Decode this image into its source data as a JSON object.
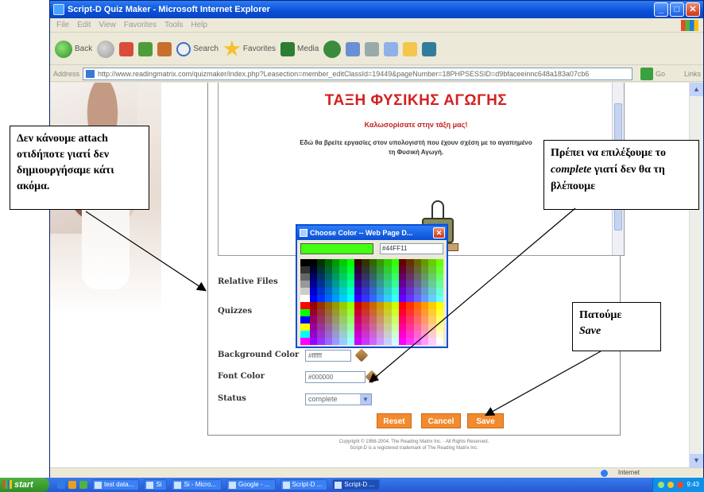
{
  "window": {
    "title": "Script-D Quiz Maker - Microsoft Internet Explorer",
    "controls": {
      "minimize": "_",
      "maximize": "□",
      "close": "✕"
    }
  },
  "menu": [
    "File",
    "Edit",
    "View",
    "Favorites",
    "Tools",
    "Help"
  ],
  "toolbar": {
    "back": "Back",
    "search": "Search",
    "favorites": "Favorites",
    "media": "Media"
  },
  "address": {
    "label": "Address",
    "url": "http://www.readingmatrix.com/quizmaker/index.php?Leasection=member_editClassId=19449&pageNumber=18PHPSESSID=d9bfaceeinnc648a183a07cb6",
    "go": "Go",
    "links": "Links"
  },
  "preview": {
    "title": "ΤΑΞΗ ΦΥΣΙΚΗΣ ΑΓΩΓΗΣ",
    "welcome": "Καλωσορίσατε στην τάξη μας!",
    "body_line1": "Εδώ θα βρείτε εργασίες στον υπολογιστή που έχουν σχέση με το αγαπημένο",
    "body_line2": "τη Φυσική Αγωγή."
  },
  "form": {
    "related_files_label": "Relative Files",
    "quizzes_label": "Quizzes",
    "background_color_label": "Background Color",
    "background_color_value": "#ffffff",
    "font_color_label": "Font Color",
    "font_color_value": "#000000",
    "status_label": "Status",
    "status_value": "complete",
    "reset": "Reset",
    "cancel": "Cancel",
    "save": "Save",
    "copyright_line1": "Copyright © 1998-2004. The Reading Matrix Inc. - All Rights Reserved.",
    "copyright_line2": "Script-D is a registered trademark of The Reading Matrix Inc."
  },
  "color_dialog": {
    "title": "Choose Color -- Web Page D...",
    "selected_hex": "#44FF11",
    "selected_color": "#44ff11"
  },
  "annotations": {
    "left": "Δεν κάνουμε attach οτιδήποτε γιατί δεν δημιουργήσαμε κάτι ακόμα.",
    "right_pre": "Πρέπει να επιλέξουμε το ",
    "right_em": "complete",
    "right_post": " γιατί δεν θα τη βλέπουμε",
    "save_pre": "Πατούμε",
    "save_em": "Save"
  },
  "statusbar": {
    "zone": "Internet"
  },
  "taskbar": {
    "start": "start",
    "tasks": [
      "test data...",
      "Si",
      "Si - Micro...",
      "Google - ...",
      "Script-D ...",
      "Script-D ..."
    ],
    "clock": "9:43"
  }
}
